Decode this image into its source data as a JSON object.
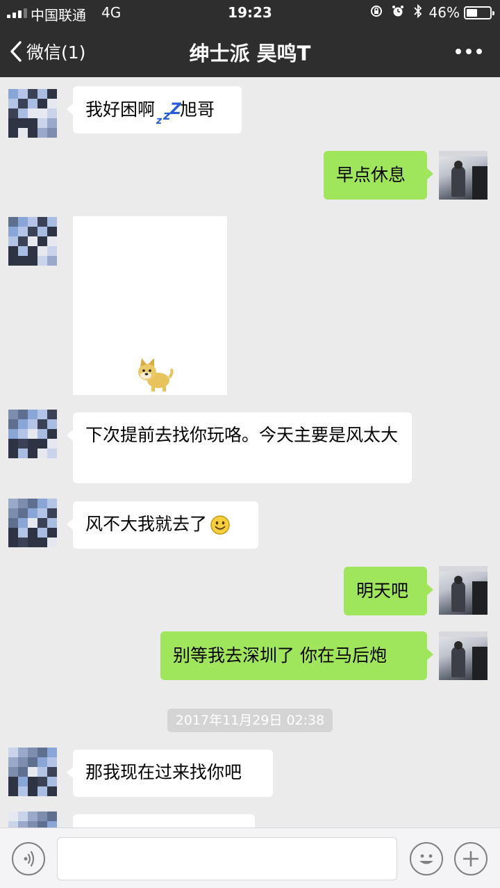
{
  "status_bar": {
    "carrier": "中国联通",
    "network": "4G",
    "time": "19:23",
    "battery_percent": "46%",
    "battery_level": 0.46,
    "icons": [
      "lock-rotation-icon",
      "alarm-icon",
      "bluetooth-icon"
    ]
  },
  "nav": {
    "back_label": "微信(1)",
    "title": "绅士派 昊鸣T",
    "more_icon": "more-dots-icon"
  },
  "messages": [
    {
      "side": "in",
      "type": "text",
      "text": "我好困啊",
      "emoji": "zzz",
      "text_after": "旭哥"
    },
    {
      "side": "out",
      "type": "text",
      "text": "早点休息"
    },
    {
      "side": "in",
      "type": "sticker",
      "sticker": "doge-dog"
    },
    {
      "side": "in",
      "type": "text",
      "text": "下次提前去找你玩咯。今天主要是风太大"
    },
    {
      "side": "in",
      "type": "text",
      "text": "风不大我就去了",
      "emoji": "smile"
    },
    {
      "side": "out",
      "type": "text",
      "text": "明天吧"
    },
    {
      "side": "out",
      "type": "text",
      "text": "别等我去深圳了 你在马后炮"
    },
    {
      "type": "timestamp",
      "text": "2017年11月29日 02:38"
    },
    {
      "side": "in",
      "type": "text",
      "text": "那我现在过来找你吧"
    }
  ],
  "input_bar": {
    "voice_icon": "voice-icon",
    "input_value": "",
    "emoji_icon": "emoji-icon",
    "plus_icon": "plus-icon"
  },
  "colors": {
    "nav_bg": "#2e2e2e",
    "chat_bg": "#ebebeb",
    "outgoing_bubble": "#9fe65c",
    "incoming_bubble": "#ffffff",
    "timestamp_bg": "#d4d4d4"
  }
}
